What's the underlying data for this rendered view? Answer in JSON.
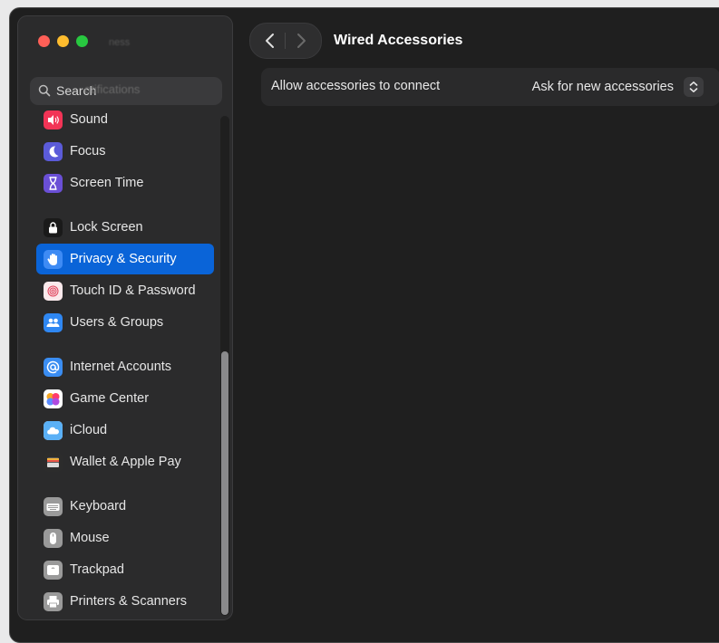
{
  "window": {
    "title": "Wired Accessories"
  },
  "search": {
    "placeholder": "Search",
    "ghost": "otifications",
    "ghost_top": "ness"
  },
  "sidebar": {
    "items": [
      {
        "label": "Sound",
        "icon": "speaker-icon",
        "color": "#f23456",
        "selected": false
      },
      {
        "label": "Focus",
        "icon": "moon-icon",
        "color": "#5b5bd9",
        "selected": false
      },
      {
        "label": "Screen Time",
        "icon": "hourglass-icon",
        "color": "#6a4fd6",
        "selected": false
      },
      {
        "label": "Lock Screen",
        "icon": "lock-icon",
        "color": "#1a1a1a",
        "selected": false
      },
      {
        "label": "Privacy & Security",
        "icon": "hand-icon",
        "color": "#3e8bf4",
        "selected": true
      },
      {
        "label": "Touch ID & Password",
        "icon": "fingerprint-icon",
        "color": "#fbe9ec",
        "selected": false
      },
      {
        "label": "Users & Groups",
        "icon": "users-icon",
        "color": "#2f87f2",
        "selected": false
      },
      {
        "label": "Internet Accounts",
        "icon": "at-icon",
        "color": "#3a8df2",
        "selected": false
      },
      {
        "label": "Game Center",
        "icon": "game-center-icon",
        "color": "#ffffff",
        "selected": false
      },
      {
        "label": "iCloud",
        "icon": "cloud-icon",
        "color": "#ffffff",
        "selected": false
      },
      {
        "label": "Wallet & Apple Pay",
        "icon": "wallet-icon",
        "color": "#2c2c2c",
        "selected": false
      },
      {
        "label": "Keyboard",
        "icon": "keyboard-icon",
        "color": "#9a9a9a",
        "selected": false
      },
      {
        "label": "Mouse",
        "icon": "mouse-icon",
        "color": "#9a9a9a",
        "selected": false
      },
      {
        "label": "Trackpad",
        "icon": "trackpad-icon",
        "color": "#9a9a9a",
        "selected": false
      },
      {
        "label": "Printers & Scanners",
        "icon": "printer-icon",
        "color": "#9a9a9a",
        "selected": false
      }
    ]
  },
  "content": {
    "setting": {
      "label": "Allow accessories to connect",
      "value": "Ask for new accessories"
    }
  },
  "colors": {
    "accent": "#0a64d8",
    "window_bg": "#1f1f1f",
    "sidebar_bg": "#2b2b2c"
  }
}
